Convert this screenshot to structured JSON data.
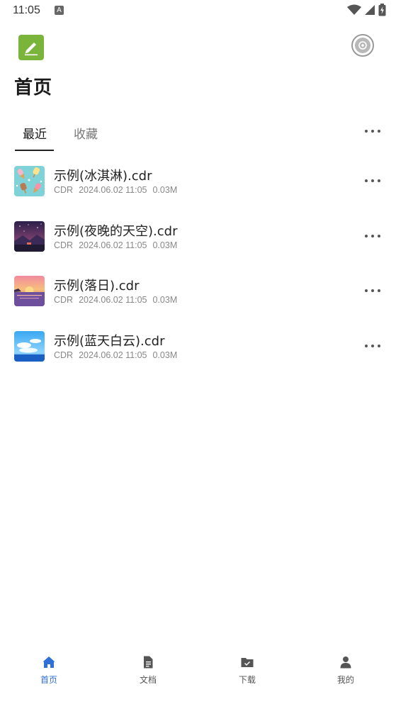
{
  "status_bar": {
    "time": "11:05",
    "notification_letter": "A"
  },
  "header": {
    "title": "首页"
  },
  "tabs": [
    {
      "label": "最近",
      "active": true
    },
    {
      "label": "收藏",
      "active": false
    }
  ],
  "files": [
    {
      "name": "示例(冰淇淋).cdr",
      "type": "CDR",
      "date": "2024.06.02 11:05",
      "size": "0.03M",
      "thumb": "icecream"
    },
    {
      "name": "示例(夜晚的天空).cdr",
      "type": "CDR",
      "date": "2024.06.02 11:05",
      "size": "0.03M",
      "thumb": "night-sky"
    },
    {
      "name": "示例(落日).cdr",
      "type": "CDR",
      "date": "2024.06.02 11:05",
      "size": "0.03M",
      "thumb": "sunset"
    },
    {
      "name": "示例(蓝天白云).cdr",
      "type": "CDR",
      "date": "2024.06.02 11:05",
      "size": "0.03M",
      "thumb": "blue-sky"
    }
  ],
  "bottom_nav": [
    {
      "label": "首页",
      "icon": "home-icon",
      "active": true
    },
    {
      "label": "文档",
      "icon": "document-icon",
      "active": false
    },
    {
      "label": "下载",
      "icon": "download-folder-icon",
      "active": false
    },
    {
      "label": "我的",
      "icon": "person-icon",
      "active": false
    }
  ],
  "colors": {
    "accent": "#2f6fd6",
    "logo": "#7bb43a",
    "inactive_icon": "#555555"
  }
}
